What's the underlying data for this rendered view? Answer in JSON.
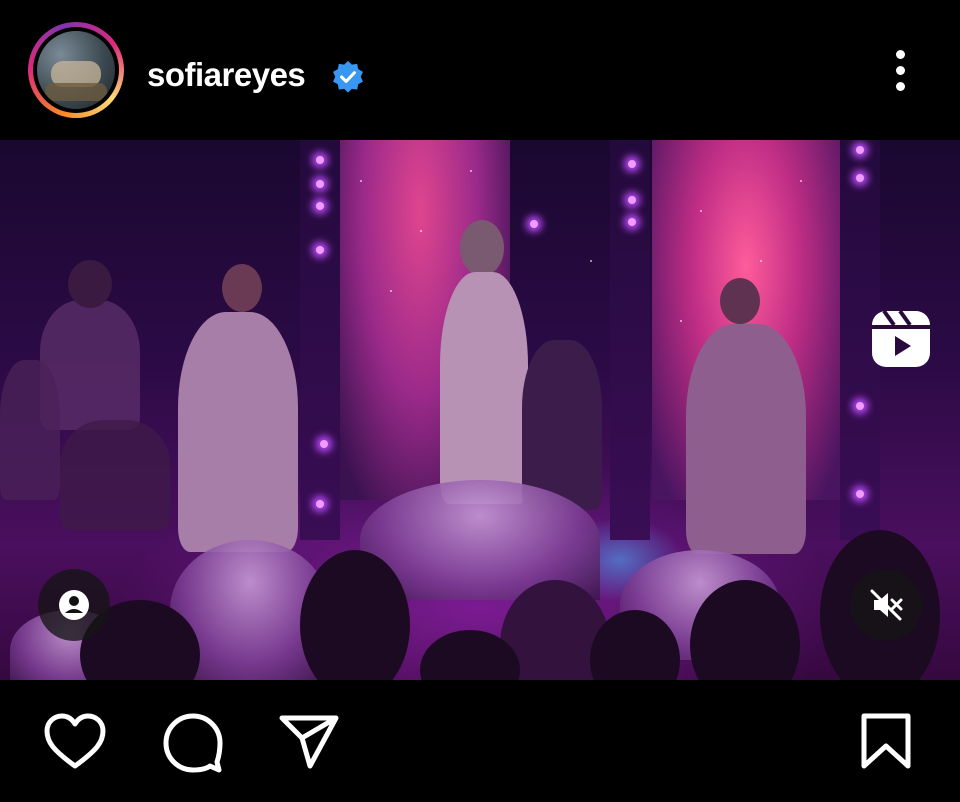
{
  "post": {
    "username": "sofiareyes",
    "verified": true,
    "media_type": "reel"
  },
  "icons": {
    "avatar": "story-ring-avatar",
    "verified": "verified-badge-icon",
    "more": "more-vertical-icon",
    "reels": "reels-icon",
    "tags": "user-tag-icon",
    "mute": "muted-speaker-icon",
    "like": "heart-icon",
    "comment": "comment-bubble-icon",
    "share": "paper-plane-icon",
    "save": "bookmark-icon"
  },
  "colors": {
    "background": "#000000",
    "verified_badge": "#3897f0",
    "story_ring_start": "#f58529",
    "story_ring_end": "#dd2a7b"
  }
}
